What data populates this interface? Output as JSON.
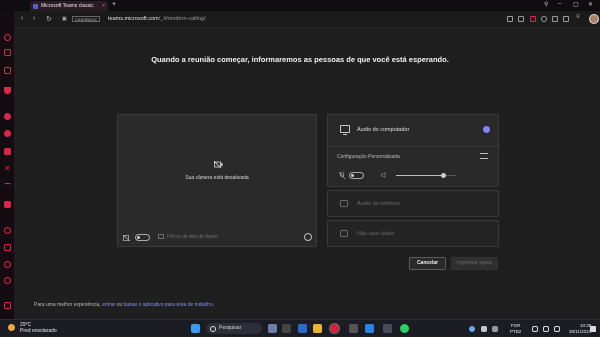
{
  "browser": {
    "tab_title": "Microsoft Teams classic",
    "tab_close": "×",
    "new_tab": "+",
    "cashback_badge": "CASHBACK",
    "url_host": "teams.microsoft.com",
    "url_path": "/_#/modern-calling/"
  },
  "page": {
    "heading": "Quando a reunião começar, informaremos as pessoas de que você está esperando.",
    "camera_status": "Sua câmera está desativada",
    "background_filters": "Filtros de tela de fundo",
    "audio_options": {
      "computer_audio": "Áudio do computador",
      "custom_config": "Configuração Personalizada",
      "phone_audio": "Áudio do telefone",
      "no_audio": "Não usar áudio"
    },
    "volume_level": 0.8,
    "cancel_button": "Cancelar",
    "join_button": "Ingressar agora",
    "footer_prefix": "Para uma melhor experiência, ",
    "footer_link1": "entrar",
    "footer_mid": " ou ",
    "footer_link2": "baixar o aplicativo para área de trabalho",
    "footer_suffix": "."
  },
  "taskbar": {
    "temperature": "29°C",
    "weather_desc": "Pred ensolarado",
    "search_placeholder": "Pesquisar",
    "lang_top": "POR",
    "lang_bottom": "PTB2",
    "time": "10:38",
    "date": "30/11/2023"
  },
  "colors": {
    "accent": "#7f85f5",
    "sidebar_accent": "#e0244a"
  }
}
